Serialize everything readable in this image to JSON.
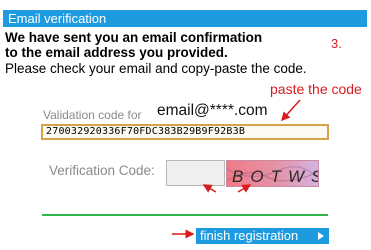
{
  "window": {
    "title": "Email verification"
  },
  "message": {
    "line1": "We have sent you an email confirmation",
    "line2": "to the email address you provided.",
    "line3": "Please check your email and copy-paste the code."
  },
  "annotations": {
    "step": "3.",
    "paste": "paste the code",
    "color": "#d81c1c"
  },
  "form": {
    "validation_label": "Validation code for",
    "email": "email@****.com",
    "validation_code": "270032920336F70FDC383B29B9F92B3B",
    "verification_label": "Verification Code:",
    "verification_value": ""
  },
  "captcha": {
    "text": "BOTWS"
  },
  "actions": {
    "finish_label": "finish registration"
  },
  "colors": {
    "accent": "#1e9be0",
    "divider": "#2fb64b",
    "code_border": "#d8a24a"
  }
}
